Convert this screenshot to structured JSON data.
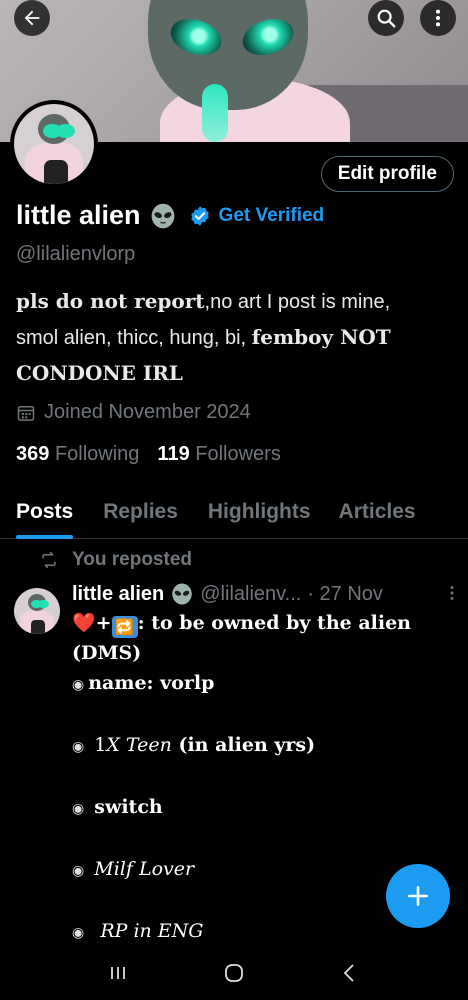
{
  "profile": {
    "display_name": "little alien",
    "get_verified_label": "Get Verified",
    "handle": "@lilalienvlorp",
    "bio": {
      "part1": "pls do not report",
      "part2": ",no art I post is mine,",
      "part3": "smol alien, thicc, hung, bi, ",
      "part4": "femboy NOT",
      "part5": "CONDONE IRL"
    },
    "joined": "Joined November 2024",
    "following_count": "369",
    "following_label": "Following",
    "followers_count": "119",
    "followers_label": "Followers",
    "edit_profile_label": "Edit profile"
  },
  "tabs": [
    {
      "label": "Posts",
      "active": true
    },
    {
      "label": "Replies",
      "active": false
    },
    {
      "label": "Highlights",
      "active": false
    },
    {
      "label": "Articles",
      "active": false
    }
  ],
  "post": {
    "reposted_label": "You reposted",
    "author": "little alien",
    "handle": "@lilalienv...",
    "time": "· 27 Nov",
    "line1_plus": "+",
    "line1_text": ": to be owned by the alien",
    "line2": "(DMS)",
    "line3": "name: vorlp",
    "line4_a": "1",
    "line4_b": "X Teen",
    "line4_c": " (in alien yrs)",
    "line5": "switch",
    "line6": "Milf Lover",
    "line7": "RP in ENG"
  },
  "icons": {
    "back": "back-arrow-icon",
    "search": "search-icon",
    "more": "more-vertical-icon",
    "calendar": "calendar-icon",
    "repost": "repost-icon",
    "verified": "verified-badge-icon",
    "compose": "plus-icon"
  },
  "colors": {
    "accent": "#1d9bf0",
    "background": "#000000",
    "muted": "#71767b"
  }
}
